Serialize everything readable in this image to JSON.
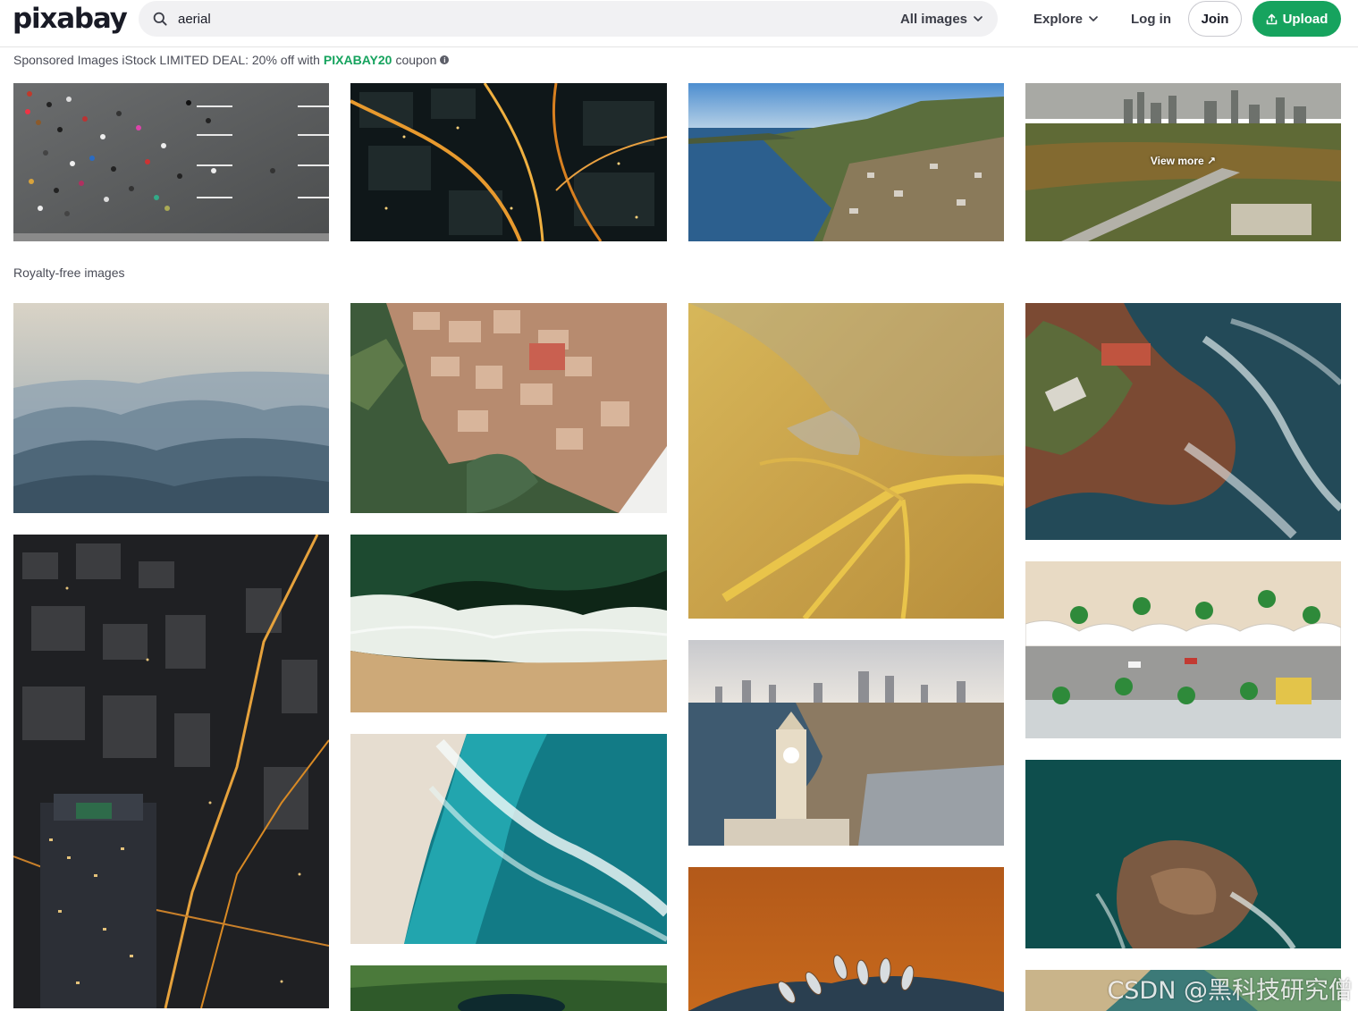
{
  "brand": {
    "logo_text": "pixabay",
    "accent_color": "#16a35e"
  },
  "header": {
    "search": {
      "value": "aerial",
      "icon": "search-icon"
    },
    "scope_label": "All images",
    "explore_label": "Explore",
    "login_label": "Log in",
    "join_label": "Join",
    "upload_label": "Upload"
  },
  "sponsored": {
    "text_before": "Sponsored Images iStock LIMITED DEAL: 20% off with",
    "coupon_code": "PIXABAY20",
    "text_after": "coupon",
    "view_more_label": "View more"
  },
  "royalty_free": {
    "title": "Royalty-free images"
  },
  "watermark": "CSDN @黑科技研究僧"
}
